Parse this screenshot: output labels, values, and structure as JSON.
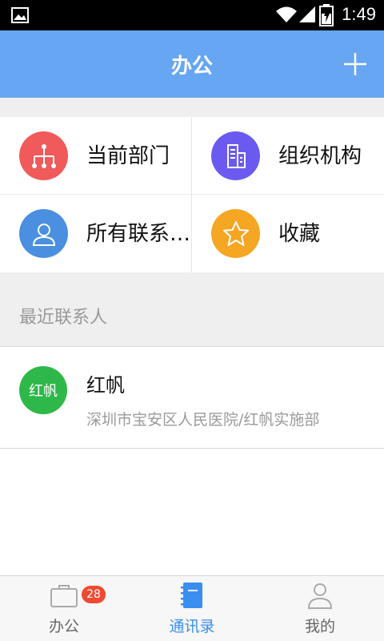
{
  "status_bar": {
    "time": "1:49"
  },
  "header": {
    "title": "办公"
  },
  "grid": {
    "items": [
      {
        "label": "当前部门",
        "icon": "org-tree-icon",
        "color": "#f05a5a"
      },
      {
        "label": "组织机构",
        "icon": "building-icon",
        "color": "#6a5af0"
      },
      {
        "label": "所有联系…",
        "icon": "person-icon",
        "color": "#4a8fe0"
      },
      {
        "label": "收藏",
        "icon": "star-icon",
        "color": "#f5a623"
      }
    ]
  },
  "recent": {
    "title": "最近联系人",
    "contacts": [
      {
        "avatar_text": "红帆",
        "name": "红帆",
        "department": "深圳市宝安区人民医院/红帆实施部",
        "avatar_color": "#2fb84a"
      }
    ]
  },
  "bottom_nav": {
    "tabs": [
      {
        "label": "办公",
        "icon": "briefcase-icon",
        "badge": "28",
        "active": false
      },
      {
        "label": "通讯录",
        "icon": "address-book-icon",
        "active": true
      },
      {
        "label": "我的",
        "icon": "profile-icon",
        "active": false
      }
    ],
    "accent_color": "#3a8ef0"
  }
}
